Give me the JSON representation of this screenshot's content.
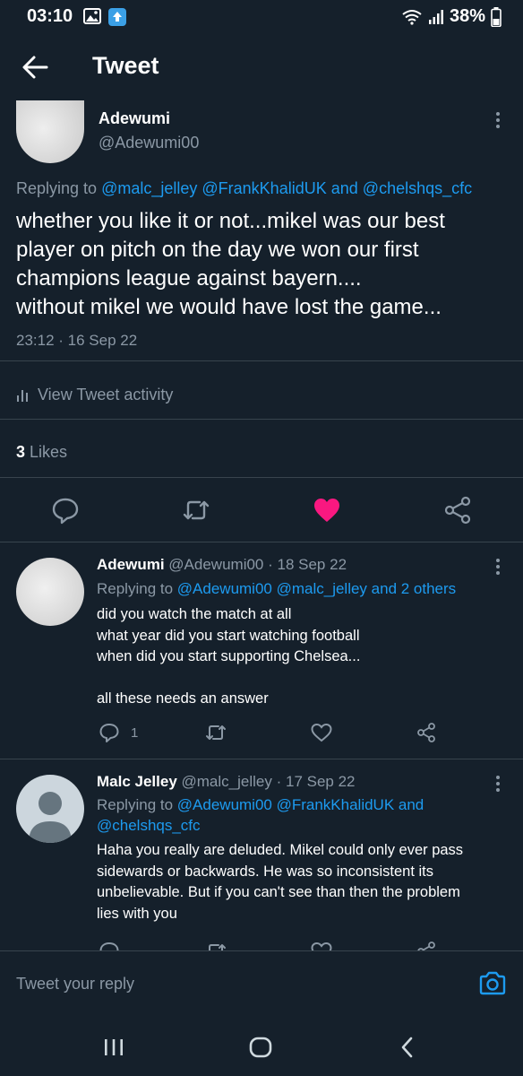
{
  "status_bar": {
    "time": "03:10",
    "battery": "38%"
  },
  "header": {
    "title": "Tweet"
  },
  "main_tweet": {
    "author_name": "Adewumi",
    "author_handle": "@Adewumi00",
    "replying_prefix": "Replying to ",
    "replying_mentions": [
      "@malc_jelley",
      "@FrankKhalidUK",
      "and",
      "@chelshqs_cfc"
    ],
    "text_lines": [
      "whether you like it or not...mikel was our best",
      "player on pitch on the day we won our first",
      "champions league against bayern....",
      "without mikel we would have lost the game..."
    ],
    "timestamp": "23:12 · 16 Sep 22",
    "activity_label": "View Tweet activity",
    "likes_count": "3",
    "likes_label": " Likes",
    "liked_color": "#f91880"
  },
  "replies": [
    {
      "name": "Adewumi",
      "handle": "@Adewumi00",
      "date": "· 18 Sep 22",
      "replying_prefix": "Replying to ",
      "replying_mentions_line": "@Adewumi00 @malc_jelley and 2 others",
      "text_lines": [
        "did you watch the match at all",
        "what year did you start watching football",
        "when did you start supporting Chelsea...",
        "",
        "all these needs an  answer"
      ],
      "reply_count": "1"
    },
    {
      "name": "Malc Jelley",
      "handle": "@malc_jelley",
      "date": "· 17 Sep 22",
      "replying_prefix": "Replying to ",
      "replying_line1_mentions": "@Adewumi00 @FrankKhalidUK and",
      "replying_line2_mentions": "@chelshqs_cfc",
      "text_lines": [
        "Haha you really are deluded. Mikel could only ever pass",
        "sidewards or backwards. He was so inconsistent its",
        "unbelievable. But if you can't see than then the problem",
        "lies with you"
      ]
    }
  ],
  "composer": {
    "placeholder": "Tweet your reply"
  },
  "colors": {
    "background": "#15202b",
    "accent": "#1d9bf0",
    "muted": "#8b98a5",
    "divider": "#38444d"
  }
}
